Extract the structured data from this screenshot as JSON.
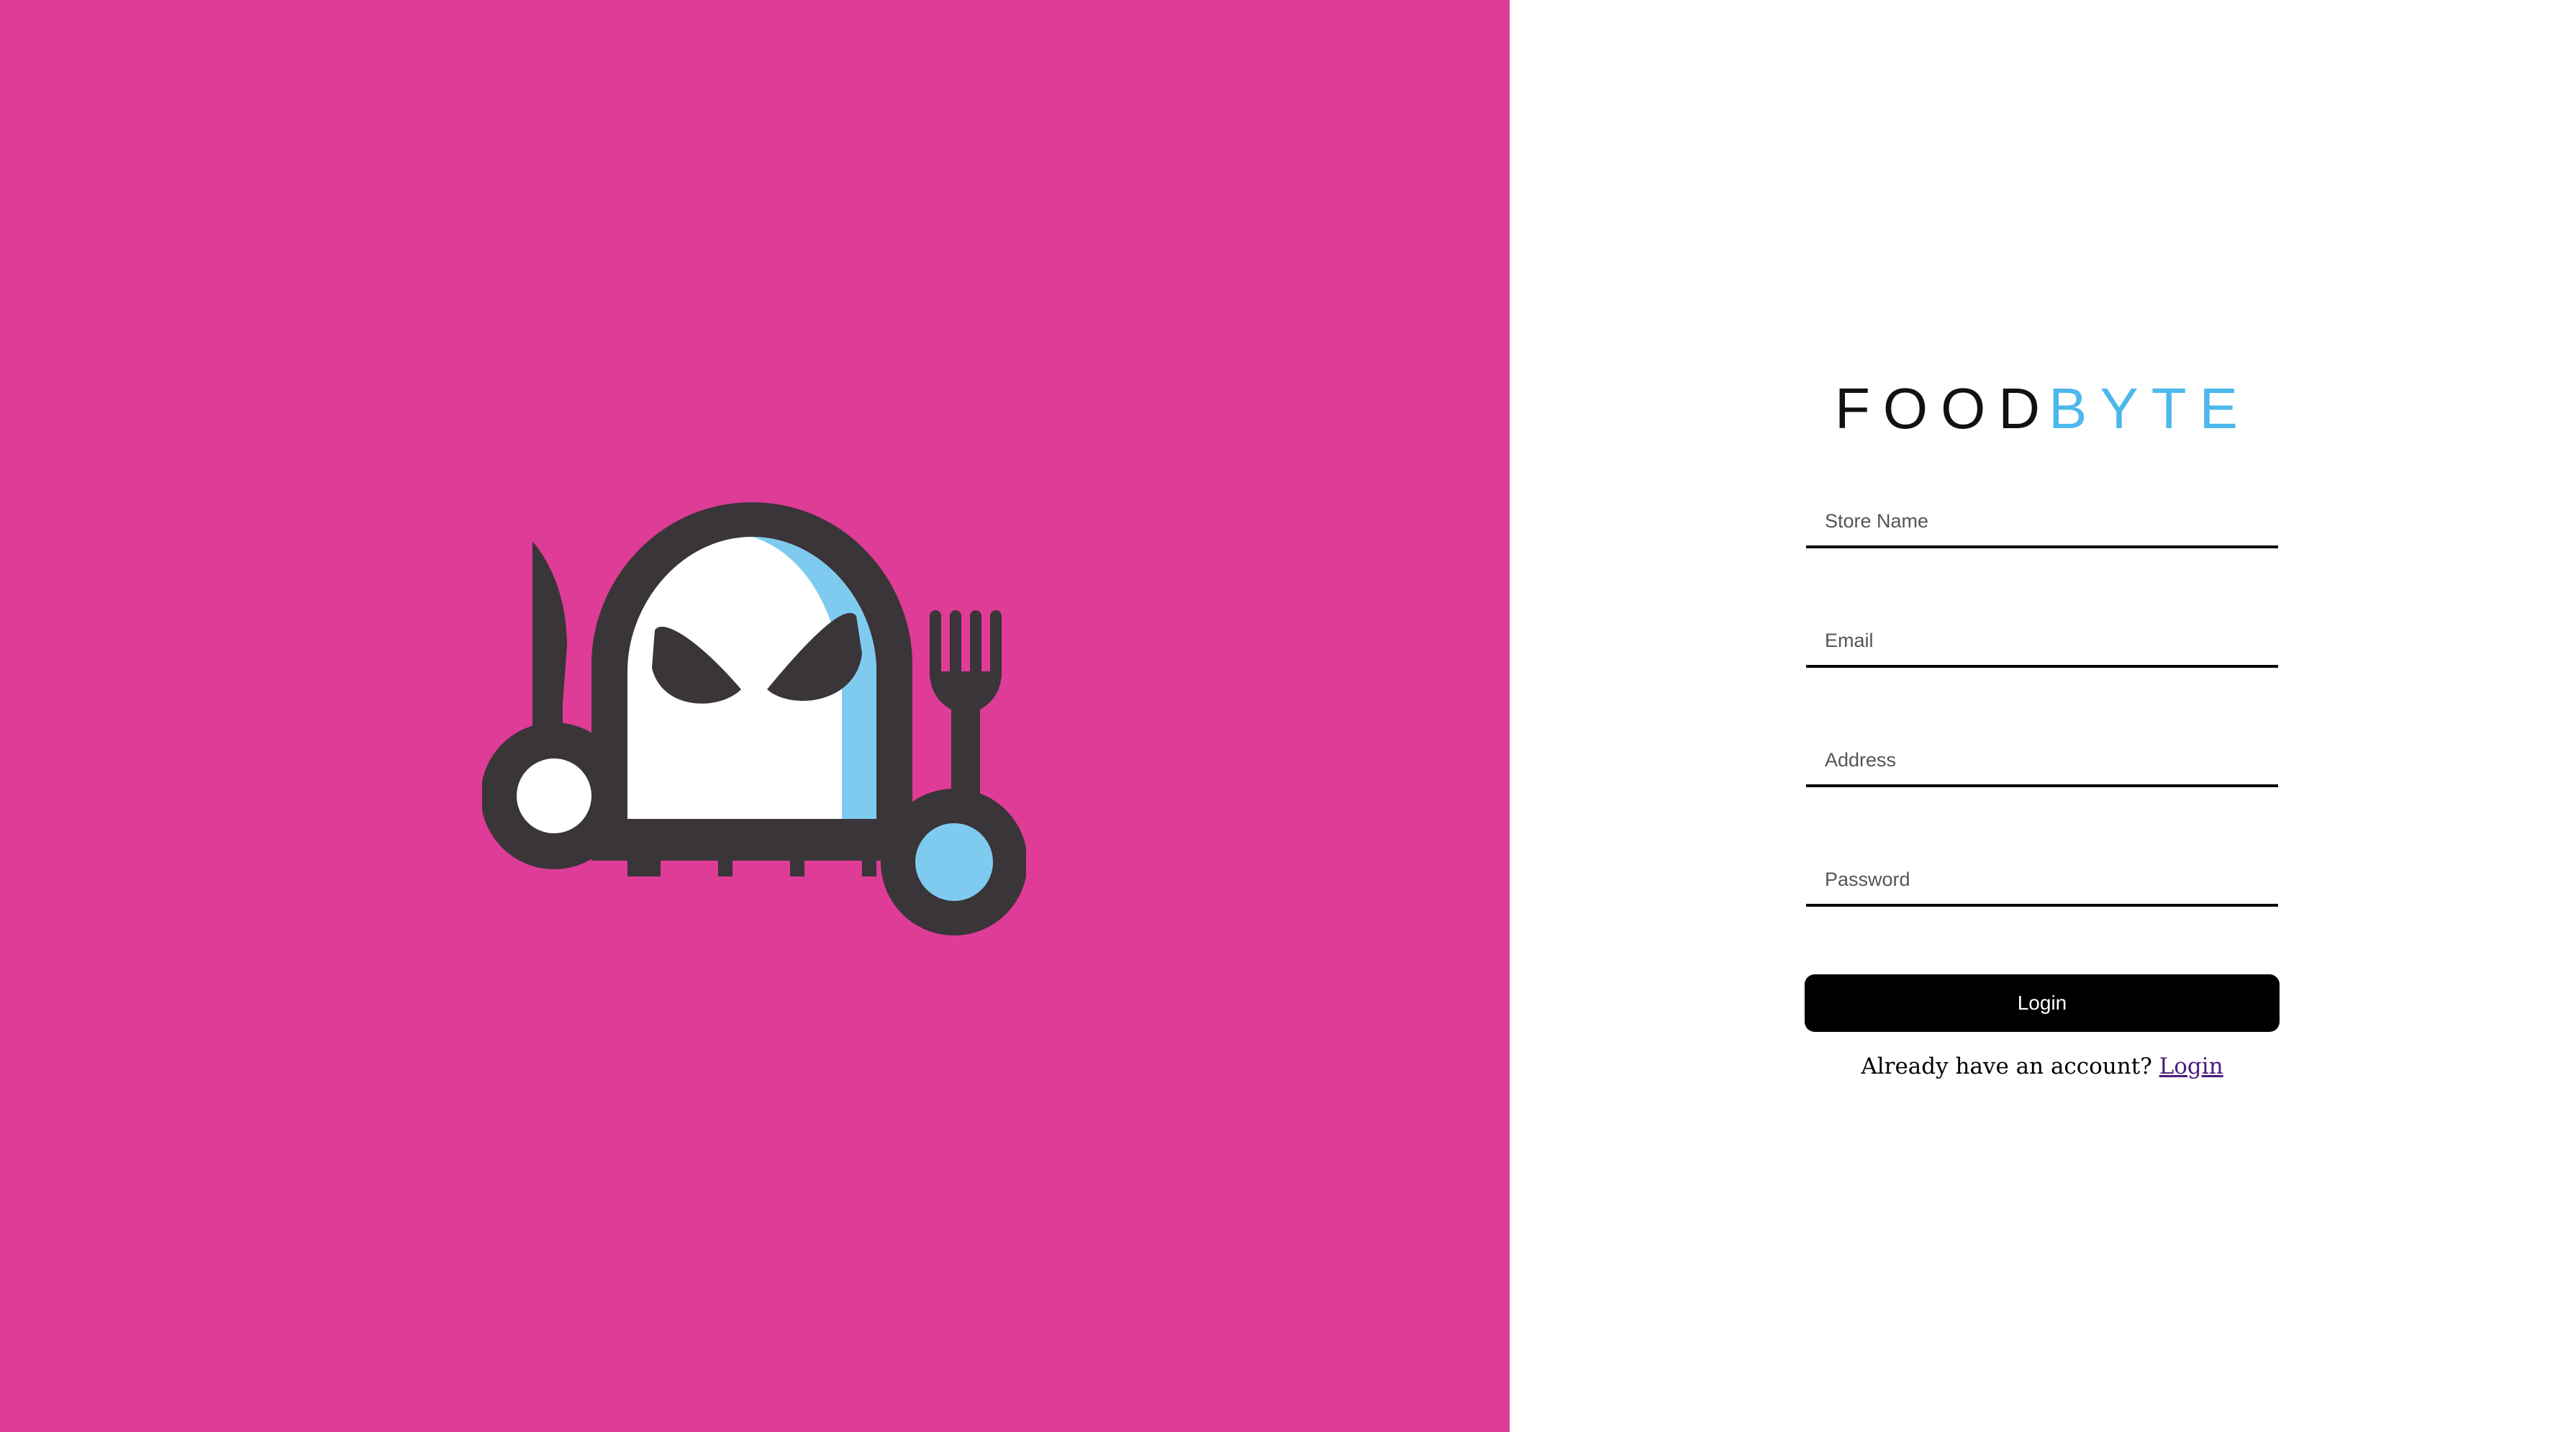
{
  "brand": {
    "part1": "FOOD",
    "part2": "BYTE",
    "color_part1": "#111111",
    "color_part2": "#4db8ec"
  },
  "logo": {
    "icon": "ghost-fork-knife-logo",
    "colors": {
      "background": "#de3c97",
      "outline": "#3a3538",
      "ghost": "#ffffff",
      "accent": "#7fcbf0"
    }
  },
  "form": {
    "store_name_placeholder": "Store Name",
    "email_placeholder": "Email",
    "address_placeholder": "Address",
    "password_placeholder": "Password",
    "submit_label": "Login"
  },
  "footer": {
    "prompt": "Already have an account?",
    "link_label": "Login"
  }
}
